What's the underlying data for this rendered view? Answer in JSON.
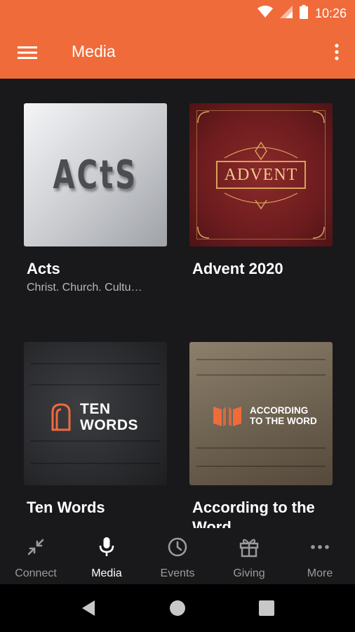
{
  "status_bar": {
    "time": "10:26"
  },
  "app_bar": {
    "title": "Media"
  },
  "media_items": [
    {
      "title": "Acts",
      "subtitle": "Christ. Church. Cultu…",
      "art_text": "ACtS"
    },
    {
      "title": "Advent 2020",
      "subtitle": "",
      "art_text": "ADVENT"
    },
    {
      "title": "Ten Words",
      "subtitle": "",
      "art_text_line1": "TEN",
      "art_text_line2": "WORDS"
    },
    {
      "title": "According to the Word",
      "subtitle": "",
      "art_text_line1": "ACCORDING",
      "art_text_line2": "TO THE WORD"
    }
  ],
  "bottom_nav": [
    {
      "label": "Connect",
      "icon": "connect-icon",
      "active": false
    },
    {
      "label": "Media",
      "icon": "microphone-icon",
      "active": true
    },
    {
      "label": "Events",
      "icon": "clock-icon",
      "active": false
    },
    {
      "label": "Giving",
      "icon": "gift-icon",
      "active": false
    },
    {
      "label": "More",
      "icon": "more-horizontal-icon",
      "active": false
    }
  ],
  "colors": {
    "accent": "#f06b3a",
    "background": "#19191b",
    "inactive": "#9b9b9b",
    "brand_orange": "#f06b3a"
  }
}
